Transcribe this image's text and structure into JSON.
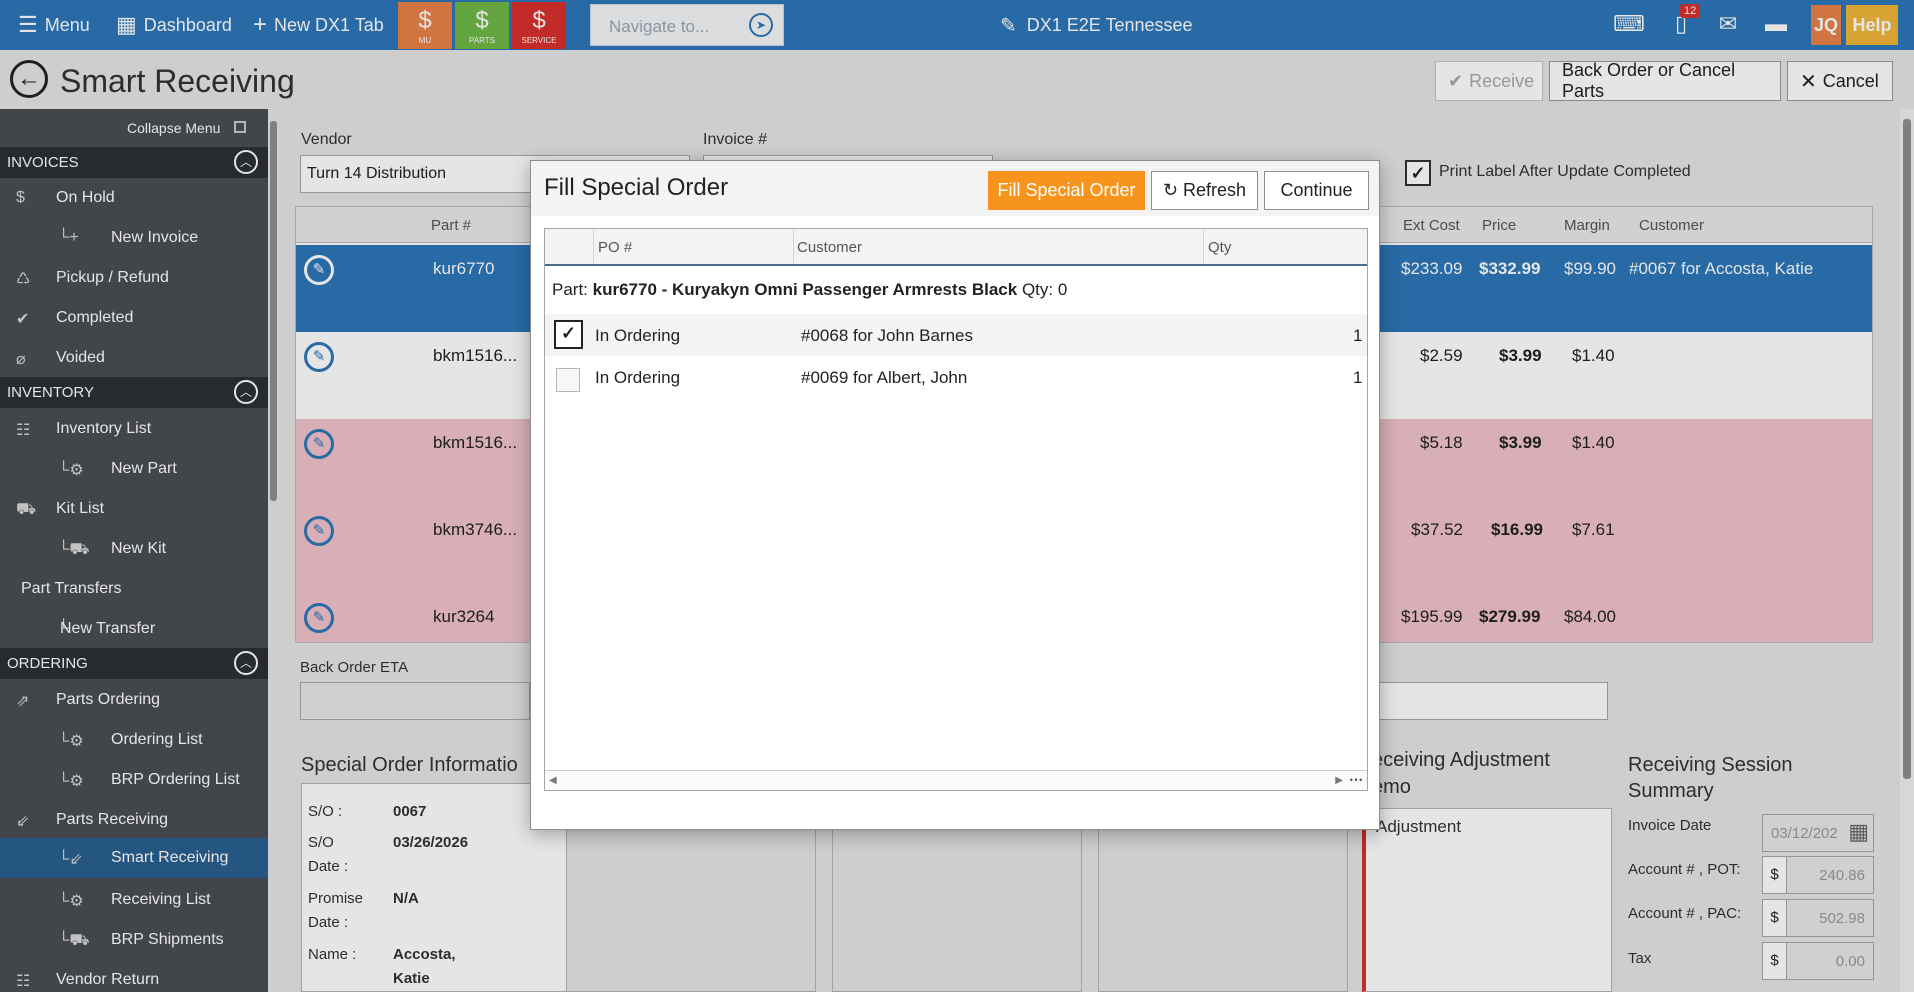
{
  "topbar": {
    "menu_label": "Menu",
    "dashboard_label": "Dashboard",
    "new_tab_label": "New DX1 Tab",
    "quick_mu": "MU",
    "quick_parts": "PARTS",
    "quick_service": "SERVICE",
    "navigate_placeholder": "Navigate to...",
    "center_title": "DX1 E2E Tennessee",
    "notification_count": "12",
    "user_initials": "JQ",
    "help_label": "Help",
    "colors": {
      "bar": "#2d77b8",
      "mu": "#e8834a",
      "parts": "#71b848",
      "service": "#d9302c",
      "user": "#e8834a",
      "help": "#f0b73a"
    }
  },
  "header": {
    "page_title": "Smart Receiving",
    "receive_label": "Receive",
    "backorder_label": "Back Order or Cancel Parts",
    "cancel_label": "Cancel"
  },
  "sidebar": {
    "collapse_label": "Collapse Menu",
    "sections": {
      "invoices": "INVOICES",
      "inventory": "INVENTORY",
      "ordering": "ORDERING"
    },
    "items": {
      "on_hold": "On Hold",
      "new_invoice": "New Invoice",
      "pickup_refund": "Pickup / Refund",
      "completed": "Completed",
      "voided": "Voided",
      "inventory_list": "Inventory List",
      "new_part": "New Part",
      "kit_list": "Kit List",
      "new_kit": "New Kit",
      "part_transfers": "Part Transfers",
      "new_transfer": "New Transfer",
      "parts_ordering": "Parts Ordering",
      "ordering_list": "Ordering List",
      "brp_ordering_list": "BRP Ordering List",
      "parts_receiving": "Parts Receiving",
      "smart_receiving": "Smart Receiving",
      "receiving_list": "Receiving List",
      "brp_shipments": "BRP Shipments",
      "vendor_return": "Vendor Return"
    }
  },
  "form": {
    "vendor_label": "Vendor",
    "vendor_value": "Turn 14 Distribution",
    "invoice_label": "Invoice #",
    "print_label": "Print Label After Update Completed",
    "print_checked": true,
    "back_order_eta_label": "Back Order ETA"
  },
  "grid": {
    "columns": {
      "part": "Part #",
      "ext_cost": "Ext Cost",
      "price": "Price",
      "margin": "Margin",
      "customer": "Customer"
    },
    "rows": [
      {
        "part": "kur6770",
        "ext_cost": "$233.09",
        "price": "$332.99",
        "margin": "$99.90",
        "customer": "#0067 for Accosta, Katie",
        "state": "selected"
      },
      {
        "part": "bkm1516...",
        "ext_cost": "$2.59",
        "price": "$3.99",
        "margin": "$1.40",
        "customer": "",
        "state": "normal"
      },
      {
        "part": "bkm1516...",
        "ext_cost": "$5.18",
        "price": "$3.99",
        "margin": "$1.40",
        "customer": "",
        "state": "pink"
      },
      {
        "part": "bkm3746...",
        "ext_cost": "$37.52",
        "price": "$16.99",
        "margin": "$7.61",
        "customer": "",
        "state": "pink"
      },
      {
        "part": "kur3264",
        "ext_cost": "$195.99",
        "price": "$279.99",
        "margin": "$84.00",
        "customer": "",
        "state": "pink"
      }
    ]
  },
  "special_order": {
    "title": "Special Order Informatio",
    "so_label": "S/O :",
    "so_value": "0067",
    "so_date_label_1": "S/O",
    "so_date_label_2": "Date :",
    "so_date_value": "03/26/2026",
    "promise_label_1": "Promise",
    "promise_label_2": "Date :",
    "promise_value": "N/A",
    "name_label": "Name :",
    "name_value_1": "Accosta,",
    "name_value_2": "Katie"
  },
  "adjustment": {
    "title_1": "eceiving Adjustment",
    "title_2": "emo",
    "text": "Adjustment"
  },
  "session_summary": {
    "title_1": "Receiving Session",
    "title_2": "Summary",
    "invoice_date_label": "Invoice Date",
    "invoice_date_value": "03/12/202",
    "pot_label": "Account # , POT:",
    "pot_value": "240.86",
    "pac_label": "Account # , PAC:",
    "pac_value": "502.98",
    "tax_label": "Tax",
    "tax_value": "0.00",
    "currency": "$"
  },
  "modal": {
    "title": "Fill Special Order",
    "fill_label": "Fill Special Order",
    "refresh_label": "Refresh",
    "continue_label": "Continue",
    "columns": {
      "po": "PO #",
      "customer": "Customer",
      "qty": "Qty"
    },
    "part_prefix": "Part:",
    "part_name": "kur6770 - Kuryakyn Omni Passenger Armrests Black",
    "part_qty": "Qty: 0",
    "rows": [
      {
        "checked": true,
        "po": "In Ordering",
        "customer": "#0068 for John Barnes",
        "qty": "1"
      },
      {
        "checked": false,
        "po": "In Ordering",
        "customer": "#0069 for Albert, John",
        "qty": "1"
      }
    ]
  }
}
